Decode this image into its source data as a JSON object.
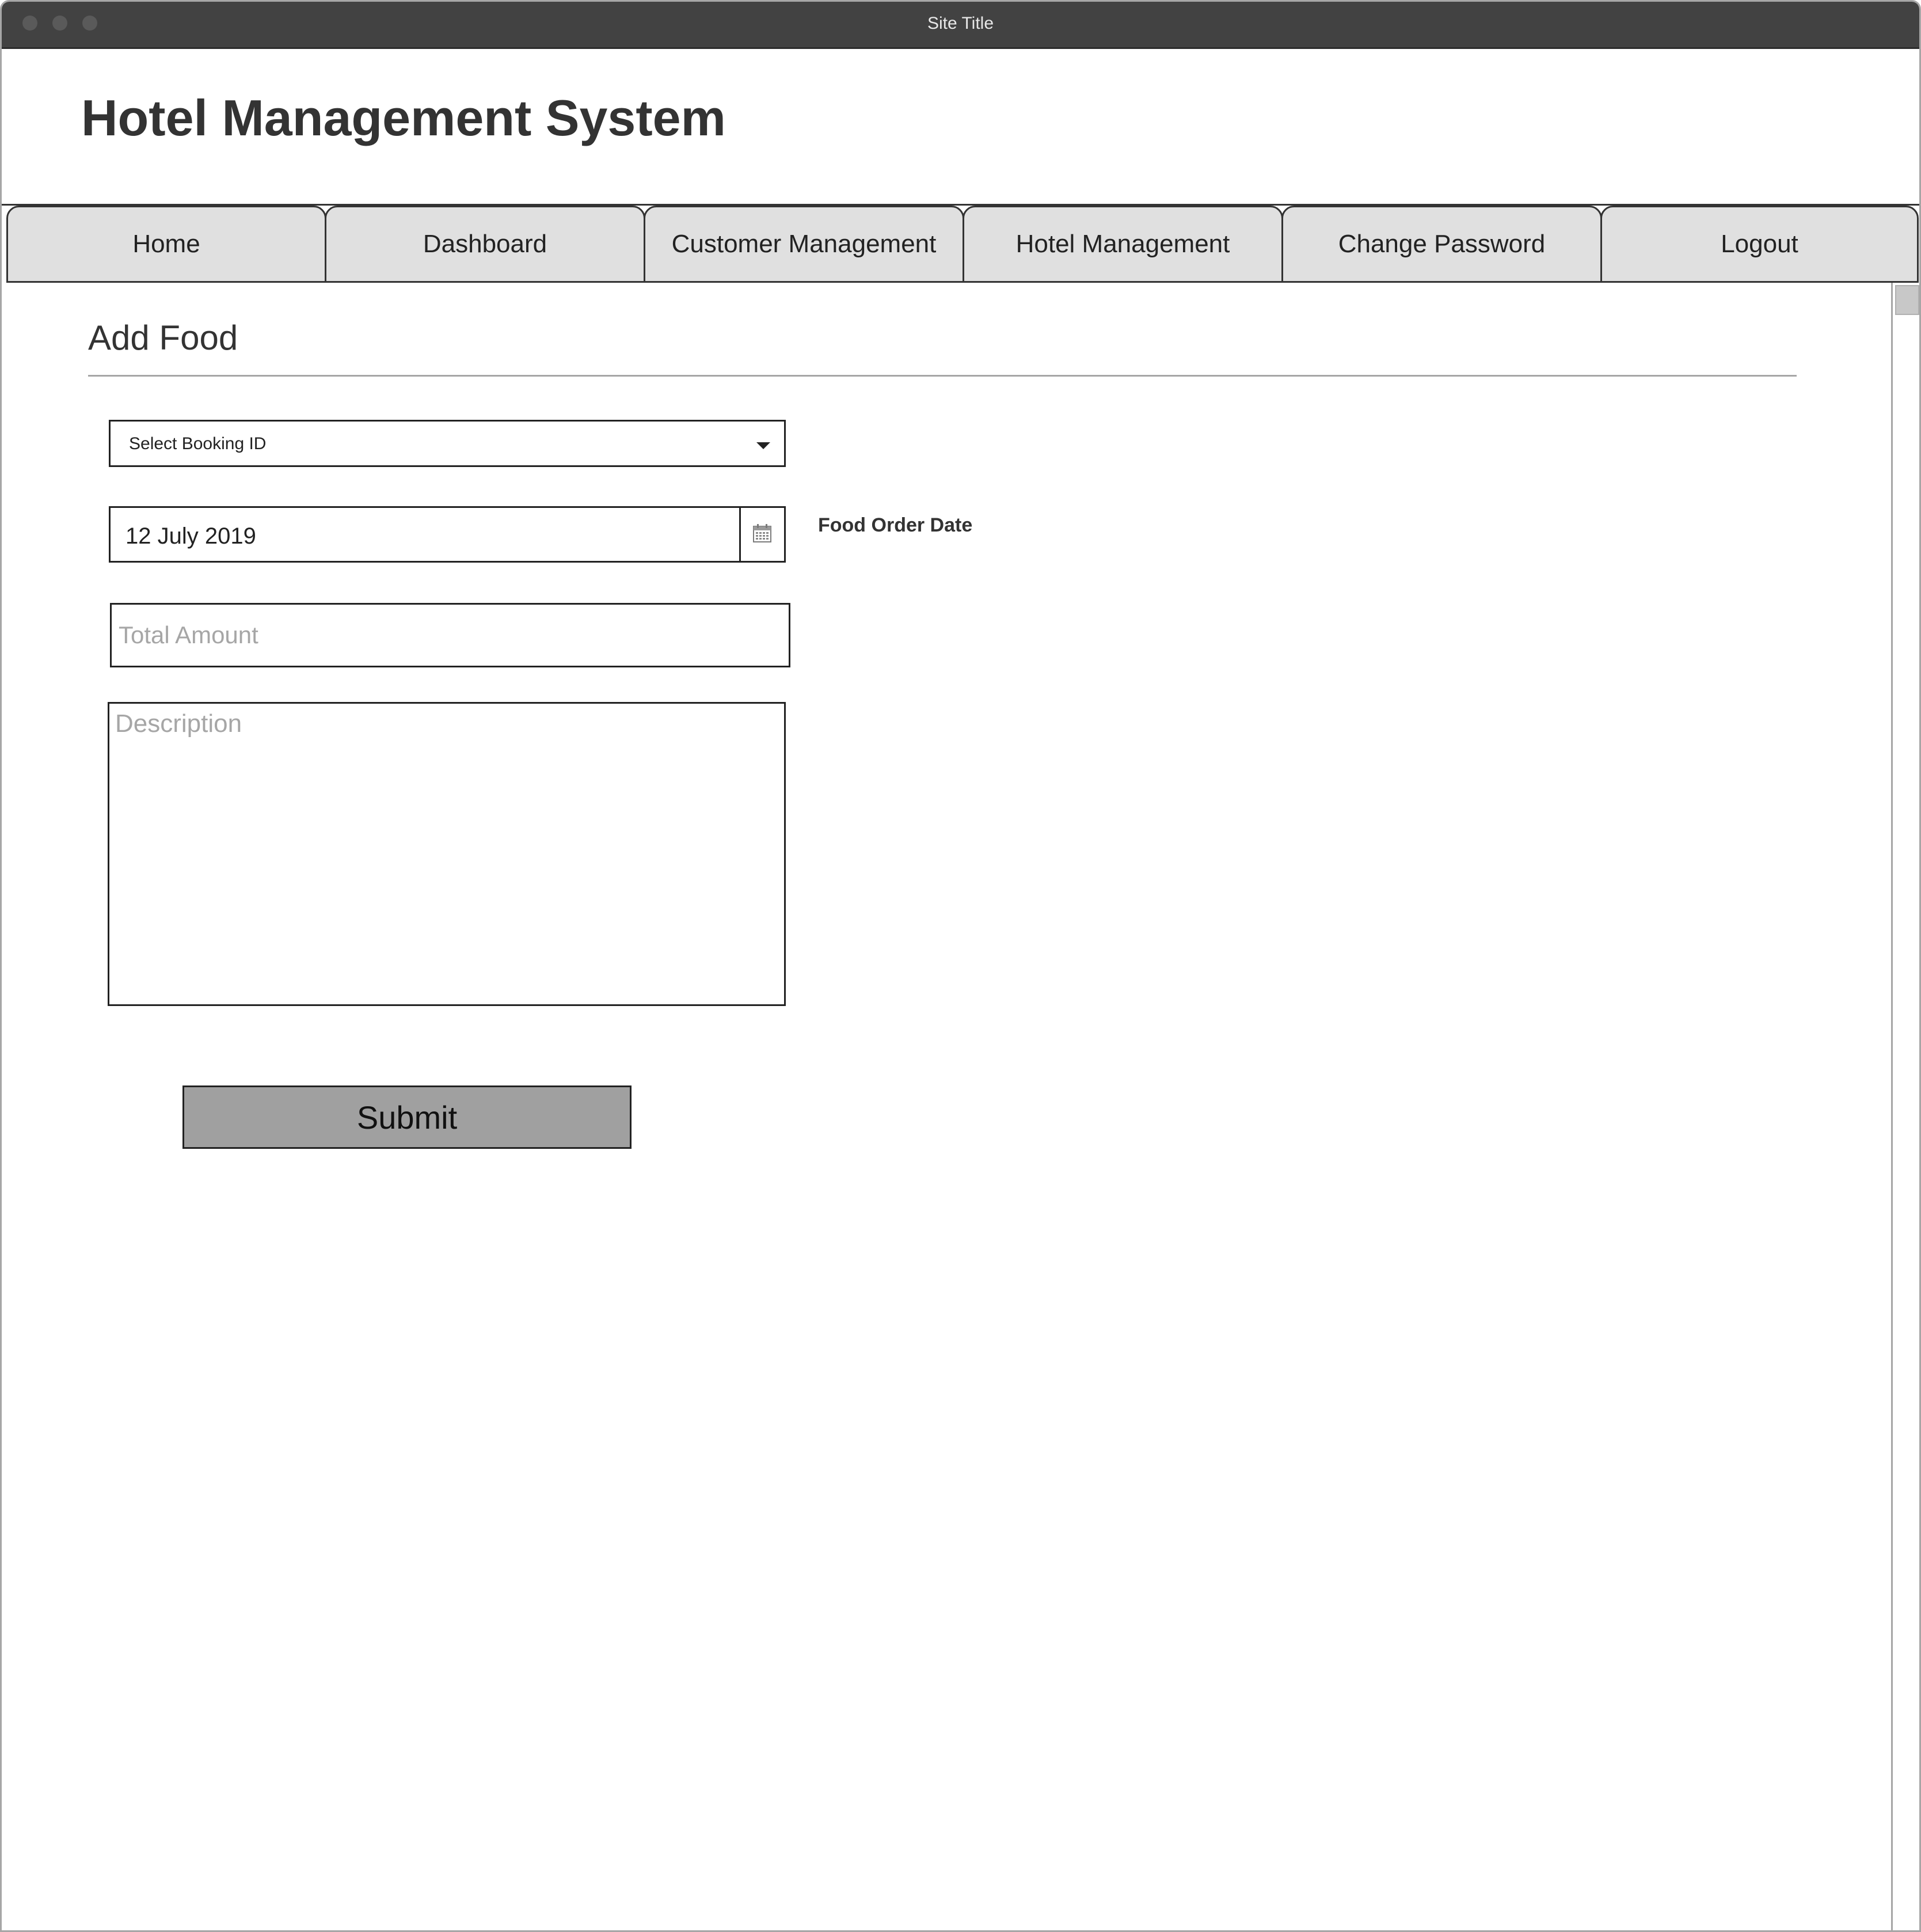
{
  "window": {
    "title": "Site Title"
  },
  "header": {
    "app_title": "Hotel Management System"
  },
  "nav": {
    "tabs": [
      {
        "label": "Home"
      },
      {
        "label": "Dashboard"
      },
      {
        "label": "Customer Management"
      },
      {
        "label": "Hotel Management"
      },
      {
        "label": "Change Password"
      },
      {
        "label": "Logout"
      }
    ]
  },
  "form": {
    "section_title": "Add Food",
    "booking_select": {
      "selected": "Select Booking ID",
      "icon": "chevron-down-icon"
    },
    "food_order_date": {
      "value": "12 July 2019",
      "label": "Food Order Date",
      "icon": "calendar-icon"
    },
    "total_amount": {
      "value": "",
      "placeholder": "Total Amount"
    },
    "description": {
      "value": "",
      "placeholder": "Description"
    },
    "submit_label": "Submit"
  },
  "colors": {
    "titlebar_bg": "#424242",
    "tab_bg": "#e0e0e0",
    "submit_bg": "#a0a0a0",
    "text": "#333333",
    "placeholder": "#a6a6a6"
  }
}
